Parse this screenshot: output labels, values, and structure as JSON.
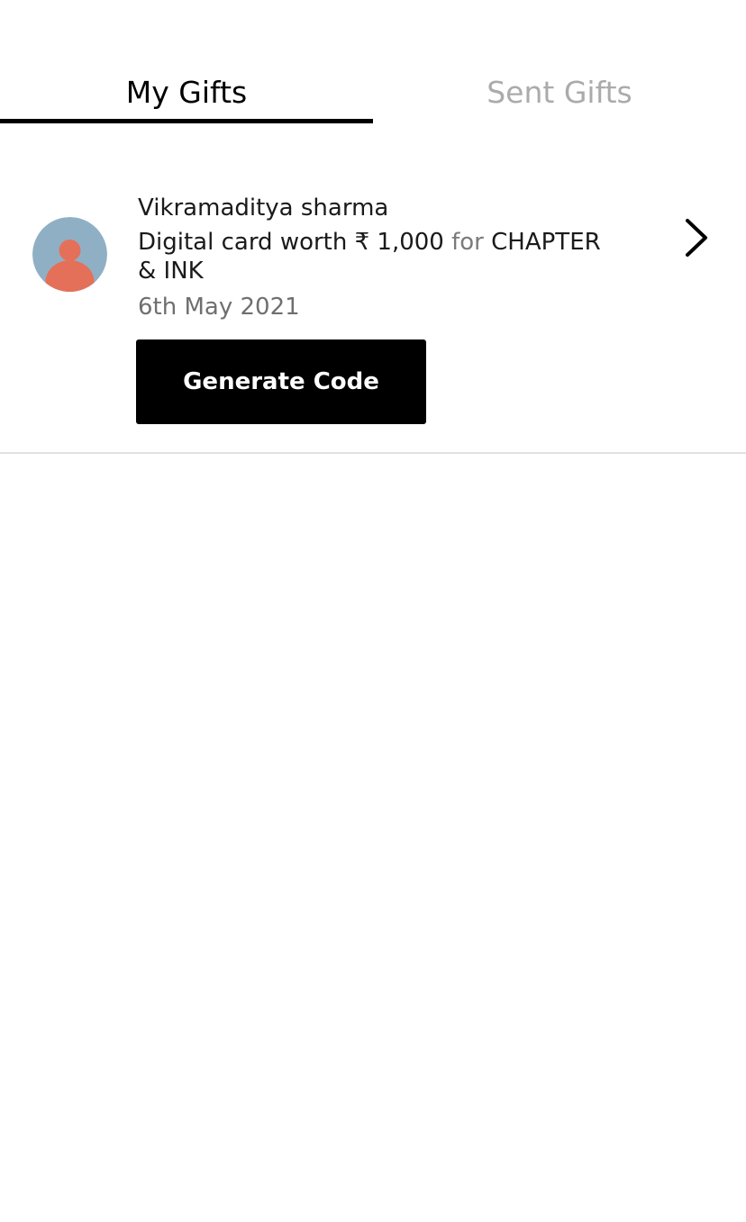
{
  "tabs": {
    "my_gifts": "My Gifts",
    "sent_gifts": "Sent Gifts",
    "active": "my_gifts"
  },
  "gift": {
    "sender": "Vikramaditya sharma",
    "desc_prefix": "Digital card worth ₹ 1,000",
    "desc_for": "for",
    "brand": "CHAPTER & INK",
    "date": "6th May 2021",
    "action_label": "Generate Code",
    "avatar_icon": "user-avatar-icon",
    "chevron_icon": "chevron-right-icon"
  },
  "colors": {
    "active_tab": "#000000",
    "inactive_tab": "#ababab",
    "button_bg": "#000000",
    "button_text": "#ffffff",
    "avatar_bg": "#8fb0c4",
    "avatar_figure": "#e5705a",
    "divider": "#e2e2e2"
  }
}
